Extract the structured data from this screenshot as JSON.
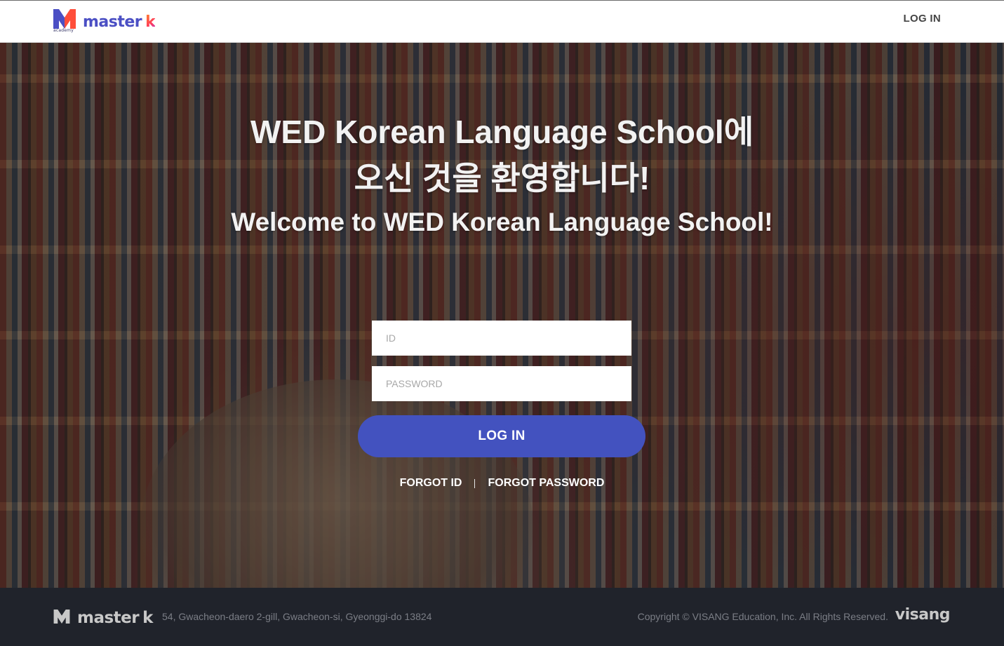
{
  "header": {
    "logo_word": "master",
    "logo_k": "k",
    "logo_sub": "academy",
    "login_link": "LOG IN"
  },
  "hero": {
    "title_kr_line1": "WED Korean Language School에",
    "title_kr_line2": "오신 것을 환영합니다!",
    "title_en": "Welcome to WED Korean Language School!",
    "id_placeholder": "ID",
    "password_placeholder": "PASSWORD",
    "login_button": "LOG IN",
    "forgot_id": "FORGOT ID",
    "forgot_password": "FORGOT PASSWORD"
  },
  "footer": {
    "logo_word": "master",
    "logo_k": "k",
    "address": "54, Gwacheon-daero 2-gill, Gwacheon-si, Gyeonggi-do 13824",
    "copyright": "Copyright © VISANG Education, Inc. All Rights Reserved.",
    "brand": "visang"
  },
  "colors": {
    "accent": "#4352bf",
    "brand_blue": "#4b4fc4",
    "footer_bg": "#20232b"
  },
  "icons": {
    "header_logo": "master-k-logo-icon",
    "footer_logo": "master-k-logo-icon",
    "footer_brand": "visang-logo-icon"
  }
}
